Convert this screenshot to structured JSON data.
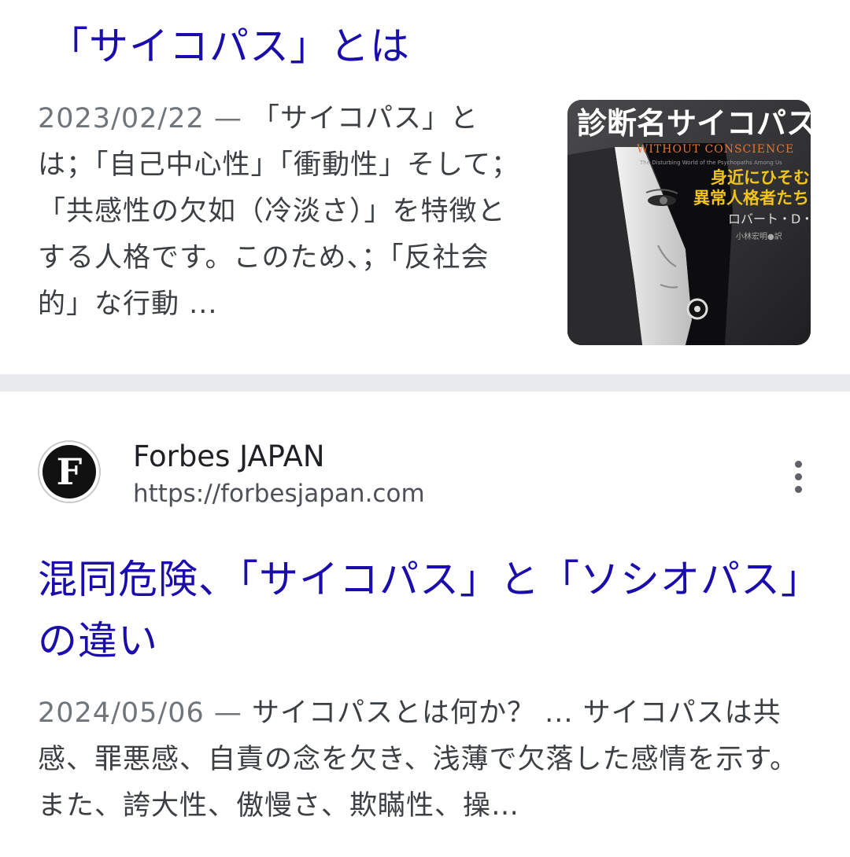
{
  "result1": {
    "title": "「サイコパス」とは",
    "date": "2023/02/22",
    "separator": " — ",
    "snippet": "「サイコパス」とは；「自己中心性」「衝動性」そして；「共感性の欠如（冷淡さ）」を特徴とする人格です。このため、；「反社会的」な行動 ...",
    "thumbnail": {
      "title": "診断名サイコパス",
      "subtitle_en": "WITHOUT CONSCIENCE",
      "subtitle_en_small": "The Disturbing World of the Psychopaths Among Us",
      "tagline_line1": "身近にひそむ",
      "tagline_line2": "異常人格者たち",
      "author": "ロバート・D・ヘア",
      "translator": "小林宏明●訳"
    }
  },
  "result2": {
    "site_name": "Forbes JAPAN",
    "site_url": "https://forbesjapan.com",
    "favicon_letter": "F",
    "title": "混同危険、「サイコパス」と「ソシオパス」の違い",
    "date": "2024/05/06",
    "separator": " — ",
    "snippet": "サイコパスとは何か？ ... サイコパスは共感、罪悪感、自責の念を欠き、浅薄で欠落した感情を示す。また、誇大性、傲慢さ、欺瞞性、操…"
  },
  "colors": {
    "link": "#1a0dab",
    "snippet_text": "#3c4043",
    "date_text": "#70757a",
    "divider": "#e8eaed"
  },
  "icons": {
    "menu": "more-vert-icon",
    "favicon": "forbes-favicon-icon"
  }
}
